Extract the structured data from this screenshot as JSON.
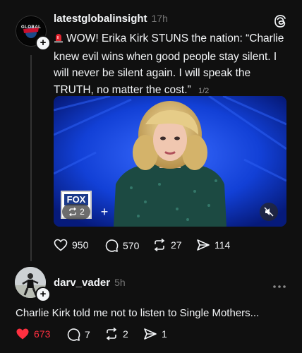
{
  "post": {
    "username": "latestglobalinsight",
    "time": "17h",
    "avatar_text": "GLOBAL",
    "text": "WOW! Erika Kirk STUNS the nation: “Charlie knew evil wins when good people stay silent. I will never be silent again. I will speak the TRUTH, no matter the cost.”",
    "pager": "1/2",
    "media": {
      "channel_logo": "FOX",
      "repost_count": "2"
    },
    "metrics": {
      "likes": "950",
      "replies": "570",
      "reposts": "27",
      "shares": "114"
    }
  },
  "reply": {
    "username": "darv_vader",
    "time": "5h",
    "text": "Charlie Kirk told me not to listen to Single Mothers...",
    "metrics": {
      "likes": "673",
      "replies": "7",
      "reposts": "2",
      "shares": "1"
    }
  },
  "colors": {
    "background": "#101010",
    "like_red": "#ff3040",
    "muted": "#777777"
  }
}
